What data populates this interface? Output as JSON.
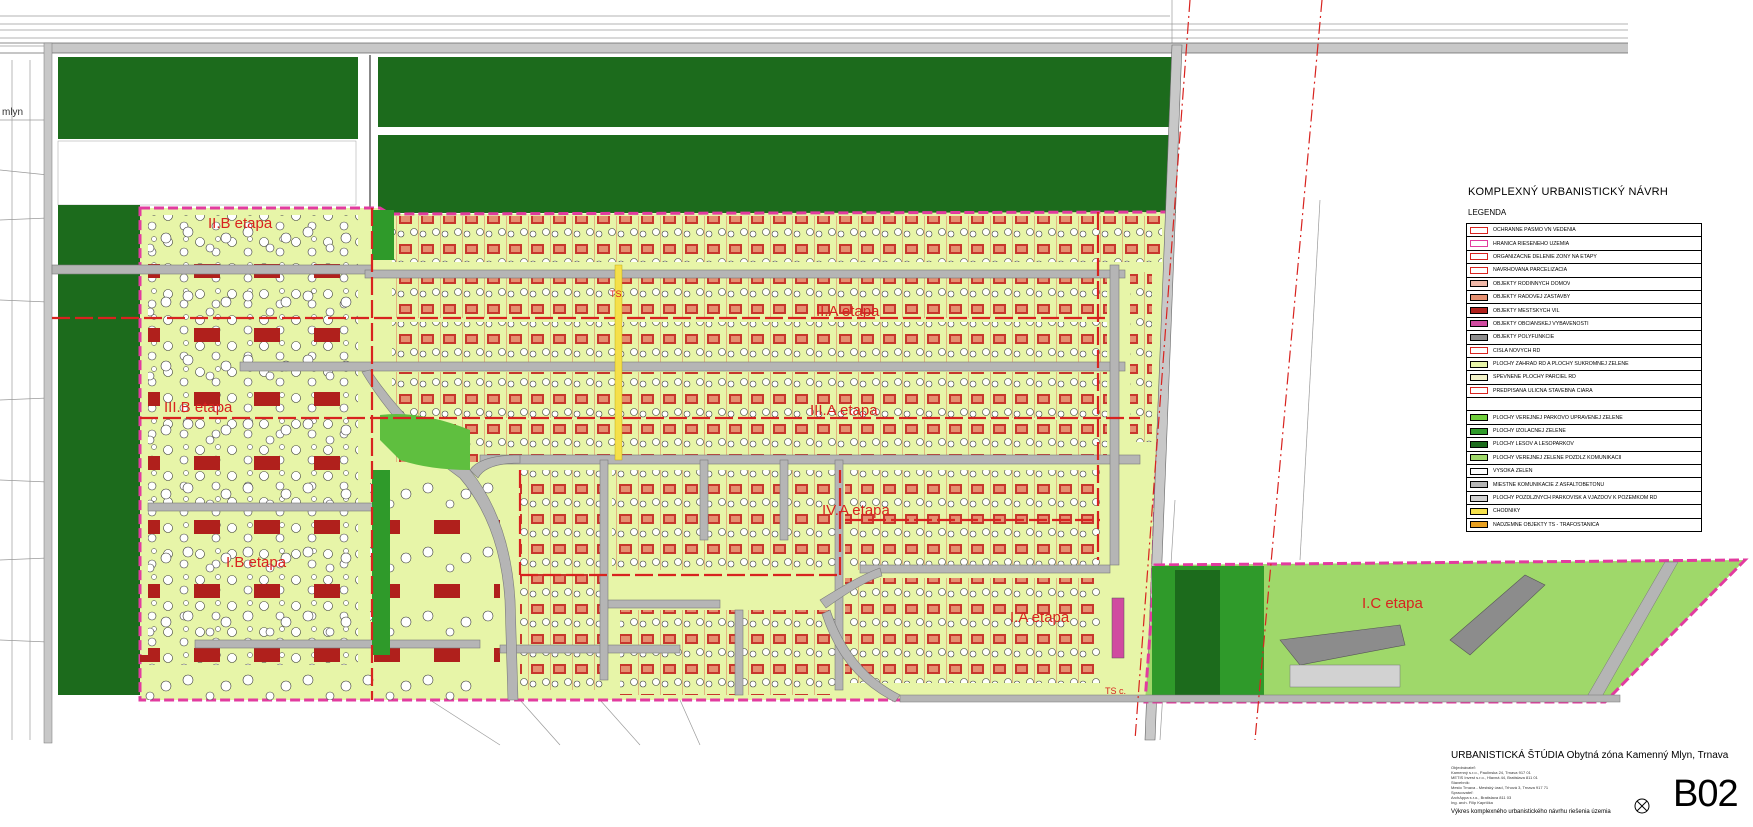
{
  "map": {
    "etapy": [
      {
        "id": "ii-b-top",
        "label": "II.B etapa"
      },
      {
        "id": "ii-a",
        "label": "II.A etapa"
      },
      {
        "id": "iii-b",
        "label": "III.B etapa"
      },
      {
        "id": "iii-a",
        "label": "III.A etapa"
      },
      {
        "id": "i-b",
        "label": "I.B etapa"
      },
      {
        "id": "iv-a",
        "label": "IV.A etapa"
      },
      {
        "id": "i-a",
        "label": "I.A etapa"
      },
      {
        "id": "i-c",
        "label": "I.C etapa"
      }
    ],
    "small_labels": {
      "ts_top": "TS",
      "ts_bottom": "TS c.",
      "mlyn": "mlyn"
    },
    "colors": {
      "residential": "#e7f5a8",
      "forest": "#1c6b1c",
      "park": "#5fbf3f",
      "road": "#b5b5b5",
      "building": "#c8372d",
      "boundary": "#e23b9f",
      "etapa_line": "#d8231f"
    }
  },
  "legend": {
    "title": "KOMPLEXNÝ URBANISTICKÝ NÁVRH",
    "subtitle": "LEGENDA",
    "items": [
      {
        "text": "OCHRANNÉ PÁSMO VN VEDENIA",
        "color": "#ffffff",
        "border": "#d8231f"
      },
      {
        "text": "HRANICA RIEŠENÉHO ÚZEMIA",
        "color": "#ffffff",
        "border": "#e23b9f"
      },
      {
        "text": "ORGANIZAČNÉ DELENIE ZÓNY NA ETAPY",
        "color": "#ffffff",
        "border": "#d8231f"
      },
      {
        "text": "NAVRHOVANÁ PARCELIZÁCIA",
        "color": "#ffffff",
        "border": "#d8231f"
      },
      {
        "text": "OBJEKTY RODINNÝCH DOMOV",
        "color": "#f0b8a8",
        "border": "#000000"
      },
      {
        "text": "OBJEKTY RADOVEJ ZÁSTAVBY",
        "color": "#e59070",
        "border": "#000000"
      },
      {
        "text": "OBJEKTY MESTSKÝCH VIL",
        "color": "#b0201c",
        "border": "#000000"
      },
      {
        "text": "OBJEKTY OBČIANSKEJ VYBAVENOSTI",
        "color": "#d04aa0",
        "border": "#000000"
      },
      {
        "text": "OBJEKTY POLYFUNKCIE",
        "color": "#8c8c8c",
        "border": "#000000"
      },
      {
        "text": "ČÍSLA NOVÝCH RD",
        "color": "#ffffff",
        "border": "#d8231f"
      },
      {
        "text": "PLOCHY ZÁHRAD RD A PLOCHY SÚKROMNEJ ZELENE",
        "color": "#e7f5a8",
        "border": "#000000"
      },
      {
        "text": "SPEVNENÉ PLOCHY PARCIEL RD",
        "color": "#f2f2c8",
        "border": "#000000"
      },
      {
        "text": "PREDPÍSANÁ ULIČNÁ STAVEBNÁ ČIARA",
        "color": "#ffffff",
        "border": "#d8231f"
      },
      {
        "text": "",
        "color": "#ffffff",
        "border": "#ffffff"
      },
      {
        "text": "PLOCHY VEREJNEJ PARKOVO UPRAVENEJ ZELENE",
        "color": "#6fce3c",
        "border": "#000000"
      },
      {
        "text": "PLOCHY IZOLAČNEJ ZELENE",
        "color": "#2f9a2a",
        "border": "#000000"
      },
      {
        "text": "PLOCHY LESOV A LESOPARKOV",
        "color": "#1c6b1c",
        "border": "#000000"
      },
      {
        "text": "PLOCHY VEREJNEJ ZELENE POZDĹŽ KOMUNIKÁCIÍ",
        "color": "#9fd86a",
        "border": "#000000"
      },
      {
        "text": "VYSOKÁ ZELEŇ",
        "color": "#ffffff",
        "border": "#000000"
      },
      {
        "text": "MIESTNE KOMUNIKÁCIE Z ASFALTOBETÓNU",
        "color": "#b5b5b5",
        "border": "#000000"
      },
      {
        "text": "PLOCHY POZDĹŽNYCH PARKOVÍSK A VJAZDOV K POZEMKOM RD",
        "color": "#d2d2d2",
        "border": "#000000"
      },
      {
        "text": "CHODNÍKY",
        "color": "#f5e04a",
        "border": "#000000"
      },
      {
        "text": "NADZEMNÉ OBJEKTY TS - TRAFOSTANICA",
        "color": "#e8a020",
        "border": "#000000"
      }
    ]
  },
  "titleblock": {
    "title": "URBANISTICKÁ ŠTÚDIA Obytná zóna Kamenný Mlyn, Trnava",
    "code": "B02",
    "description": "Výkres komplexného urbanistického návrhu riešenia územia",
    "small_lines": [
      "Objednávateľ:",
      "Kamenný s.r.o., Paulínska 24, Trnava 917 01",
      "METIS Invest s.r.o., Hlavná 44, Bratislava 811 01",
      "Stavebník:",
      "Mesto Trnava - Mestský úrad, Trhová 3, Trnava 917 71",
      "Spracovateľ:",
      "ArchAppa s.r.o., Bratislava 811 03",
      "Ing. arch. Filip Kaprička"
    ]
  }
}
